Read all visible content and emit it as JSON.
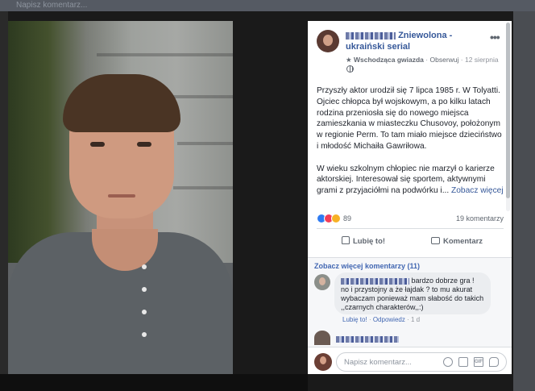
{
  "background": {
    "top_text": "Napisz komentarz..."
  },
  "post": {
    "page_name": "Zniewolona - ukraiński serial",
    "badge": "Wschodząca gwiazda",
    "follow": "Obserwuj",
    "date": "12 sierpnia",
    "paragraphs": [
      "Przyszły aktor urodził się 7 lipca 1985 r. W Tolyatti. Ojciec chłopca był wojskowym, a po kilku latach rodzina przeniosła się do nowego miejsca zamieszkania w miasteczku Chusovoy, położonym w regionie Perm. To tam miało miejsce dzieciństwo i młodość Michaiła Gawriłowa.",
      "W wieku szkolnym chłopiec nie marzył o karierze aktorskiej. Interesował się sportem, aktywnymi grami z przyjaciółmi na podwórku i..."
    ],
    "see_more": "Zobacz więcej",
    "reaction_count": "89",
    "comments_count": "19 komentarzy",
    "like_label": "Lubię to!",
    "comment_label": "Komentarz"
  },
  "comments": {
    "more_label": "Zobacz więcej komentarzy (11)",
    "first": {
      "text_line1": "bardzo dobrze gra !",
      "text_rest": "no i przystojny a że łajdak ? to mu akurat wybaczam ponieważ mam słabość do takich ,,czarnych charakterów,,:)",
      "like": "Lubię to!",
      "reply": "Odpowiedz",
      "time": "1 d"
    }
  },
  "composer": {
    "placeholder": "Napisz komentarz..."
  },
  "icons": {
    "like": "thumbs-up-icon",
    "comment": "speech-bubble-icon",
    "more": "ellipsis-icon",
    "emoji": "smiley-icon",
    "camera": "camera-icon",
    "gif": "gif-icon",
    "sticker": "sticker-icon"
  },
  "colors": {
    "link_blue": "#365899",
    "reaction_like": "#2e7bf2",
    "reaction_love": "#f33e58",
    "reaction_haha": "#f7b125"
  }
}
